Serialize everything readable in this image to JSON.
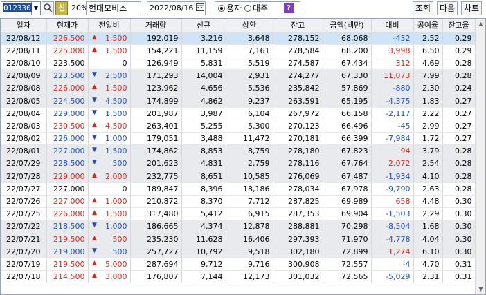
{
  "toolbar": {
    "code": "012330",
    "shin_label": "신",
    "pct_label": "20%",
    "stock_name": "현대모비스",
    "date": "2022/08/16",
    "radio_amount": "용자",
    "radio_lend": "대주",
    "help_label": "?",
    "query_label": "조회",
    "next_label": "다음",
    "chart_label": "차트"
  },
  "colors": {
    "up": "#d4281f",
    "down": "#1f4fc2",
    "selected_row": "#cfe4f7",
    "group_row": "#e9eaed"
  },
  "columns": [
    "일자",
    "현재가",
    "전일비",
    "거래량",
    "신규",
    "상환",
    "잔고",
    "금액(백만)",
    "대비",
    "공여율",
    "잔고율"
  ],
  "rows": [
    {
      "date": "22/08/12",
      "price": "226,500",
      "dir": "up",
      "change": "1,500",
      "volume": "192,019",
      "new": "3,216",
      "repay": "3,648",
      "balance": "278,152",
      "amount": "68,068",
      "diff": "-432",
      "diff_dir": "down",
      "rate": "2.52",
      "bal_rate": "0.29",
      "style": "sel"
    },
    {
      "date": "22/08/11",
      "price": "225,000",
      "dir": "up",
      "change": "1,500",
      "volume": "154,221",
      "new": "11,159",
      "repay": "7,161",
      "balance": "278,584",
      "amount": "68,200",
      "diff": "3,998",
      "diff_dir": "up",
      "rate": "6.50",
      "bal_rate": "0.29",
      "style": ""
    },
    {
      "date": "22/08/10",
      "price": "223,500",
      "dir": "flat",
      "change": "0",
      "volume": "126,949",
      "new": "5,831",
      "repay": "5,519",
      "balance": "274,587",
      "amount": "67,434",
      "diff": "312",
      "diff_dir": "up",
      "rate": "4.69",
      "bal_rate": "0.28",
      "style": ""
    },
    {
      "date": "22/08/09",
      "price": "223,500",
      "dir": "down",
      "change": "2,500",
      "volume": "171,293",
      "new": "14,004",
      "repay": "2,931",
      "balance": "274,277",
      "amount": "67,330",
      "diff": "11,073",
      "diff_dir": "up",
      "rate": "7.99",
      "bal_rate": "0.28",
      "style": "grp"
    },
    {
      "date": "22/08/08",
      "price": "226,000",
      "dir": "up",
      "change": "1,500",
      "volume": "123,962",
      "new": "4,656",
      "repay": "5,536",
      "balance": "235,842",
      "amount": "57,869",
      "diff": "-880",
      "diff_dir": "down",
      "rate": "2.30",
      "bal_rate": "0.24",
      "style": "grp"
    },
    {
      "date": "22/08/05",
      "price": "224,500",
      "dir": "down",
      "change": "4,500",
      "volume": "174,899",
      "new": "4,862",
      "repay": "9,237",
      "balance": "263,591",
      "amount": "65,195",
      "diff": "-4,375",
      "diff_dir": "down",
      "rate": "1.83",
      "bal_rate": "0.27",
      "style": "grp"
    },
    {
      "date": "22/08/04",
      "price": "229,000",
      "dir": "down",
      "change": "1,500",
      "volume": "201,987",
      "new": "3,987",
      "repay": "6,104",
      "balance": "267,972",
      "amount": "66,158",
      "diff": "-2,117",
      "diff_dir": "down",
      "rate": "2.22",
      "bal_rate": "0.27",
      "style": ""
    },
    {
      "date": "22/08/03",
      "price": "230,500",
      "dir": "up",
      "change": "4,500",
      "volume": "263,401",
      "new": "5,255",
      "repay": "5,300",
      "balance": "270,123",
      "amount": "66,496",
      "diff": "-45",
      "diff_dir": "down",
      "rate": "2.99",
      "bal_rate": "0.27",
      "style": ""
    },
    {
      "date": "22/08/02",
      "price": "226,000",
      "dir": "down",
      "change": "1,000",
      "volume": "179,051",
      "new": "3,488",
      "repay": "11,472",
      "balance": "270,181",
      "amount": "66,399",
      "diff": "-7,984",
      "diff_dir": "down",
      "rate": "1.72",
      "bal_rate": "0.27",
      "style": ""
    },
    {
      "date": "22/08/01",
      "price": "227,000",
      "dir": "down",
      "change": "1,500",
      "volume": "174,862",
      "new": "8,853",
      "repay": "8,759",
      "balance": "278,180",
      "amount": "67,823",
      "diff": "94",
      "diff_dir": "up",
      "rate": "3.79",
      "bal_rate": "0.28",
      "style": "grp"
    },
    {
      "date": "22/07/29",
      "price": "228,500",
      "dir": "down",
      "change": "500",
      "volume": "201,623",
      "new": "4,831",
      "repay": "2,759",
      "balance": "278,116",
      "amount": "67,764",
      "diff": "2,072",
      "diff_dir": "up",
      "rate": "2.54",
      "bal_rate": "0.28",
      "style": "grp"
    },
    {
      "date": "22/07/28",
      "price": "229,000",
      "dir": "up",
      "change": "2,000",
      "volume": "232,775",
      "new": "8,651",
      "repay": "10,585",
      "balance": "276,069",
      "amount": "67,487",
      "diff": "-1,934",
      "diff_dir": "down",
      "rate": "4.10",
      "bal_rate": "0.28",
      "style": "grp"
    },
    {
      "date": "22/07/27",
      "price": "227,000",
      "dir": "flat",
      "change": "0",
      "volume": "189,847",
      "new": "8,396",
      "repay": "18,186",
      "balance": "278,034",
      "amount": "67,978",
      "diff": "-9,790",
      "diff_dir": "down",
      "rate": "2.63",
      "bal_rate": "0.28",
      "style": ""
    },
    {
      "date": "22/07/26",
      "price": "227,000",
      "dir": "up",
      "change": "1,000",
      "volume": "210,872",
      "new": "8,370",
      "repay": "7,712",
      "balance": "287,825",
      "amount": "69,989",
      "diff": "658",
      "diff_dir": "up",
      "rate": "4.48",
      "bal_rate": "0.30",
      "style": ""
    },
    {
      "date": "22/07/25",
      "price": "226,000",
      "dir": "up",
      "change": "1,500",
      "volume": "317,480",
      "new": "5,412",
      "repay": "6,915",
      "balance": "287,353",
      "amount": "69,904",
      "diff": "-1,503",
      "diff_dir": "down",
      "rate": "2.29",
      "bal_rate": "0.30",
      "style": ""
    },
    {
      "date": "22/07/22",
      "price": "218,500",
      "dir": "down",
      "change": "1,000",
      "volume": "186,665",
      "new": "4,374",
      "repay": "12,878",
      "balance": "288,881",
      "amount": "70,298",
      "diff": "-8,504",
      "diff_dir": "down",
      "rate": "1.68",
      "bal_rate": "0.30",
      "style": "grp"
    },
    {
      "date": "22/07/21",
      "price": "219,500",
      "dir": "up",
      "change": "500",
      "volume": "235,230",
      "new": "11,628",
      "repay": "16,406",
      "balance": "297,393",
      "amount": "71,970",
      "diff": "-4,778",
      "diff_dir": "down",
      "rate": "4.04",
      "bal_rate": "0.30",
      "style": "grp"
    },
    {
      "date": "22/07/20",
      "price": "219,000",
      "dir": "down",
      "change": "500",
      "volume": "257,727",
      "new": "10,792",
      "repay": "9,518",
      "balance": "302,180",
      "amount": "72,899",
      "diff": "1,274",
      "diff_dir": "up",
      "rate": "6.10",
      "bal_rate": "0.30",
      "style": "grp"
    },
    {
      "date": "22/07/19",
      "price": "219,500",
      "dir": "up",
      "change": "5,000",
      "volume": "287,694",
      "new": "9,712",
      "repay": "9,716",
      "balance": "300,908",
      "amount": "72,557",
      "diff": "-4",
      "diff_dir": "down",
      "rate": "4.70",
      "bal_rate": "0.31",
      "style": ""
    },
    {
      "date": "22/07/18",
      "price": "214,500",
      "dir": "up",
      "change": "3,000",
      "volume": "176,807",
      "new": "7,144",
      "repay": "12,173",
      "balance": "301,032",
      "amount": "72,565",
      "diff": "-5,029",
      "diff_dir": "down",
      "rate": "2.31",
      "bal_rate": "0.31",
      "style": ""
    }
  ]
}
